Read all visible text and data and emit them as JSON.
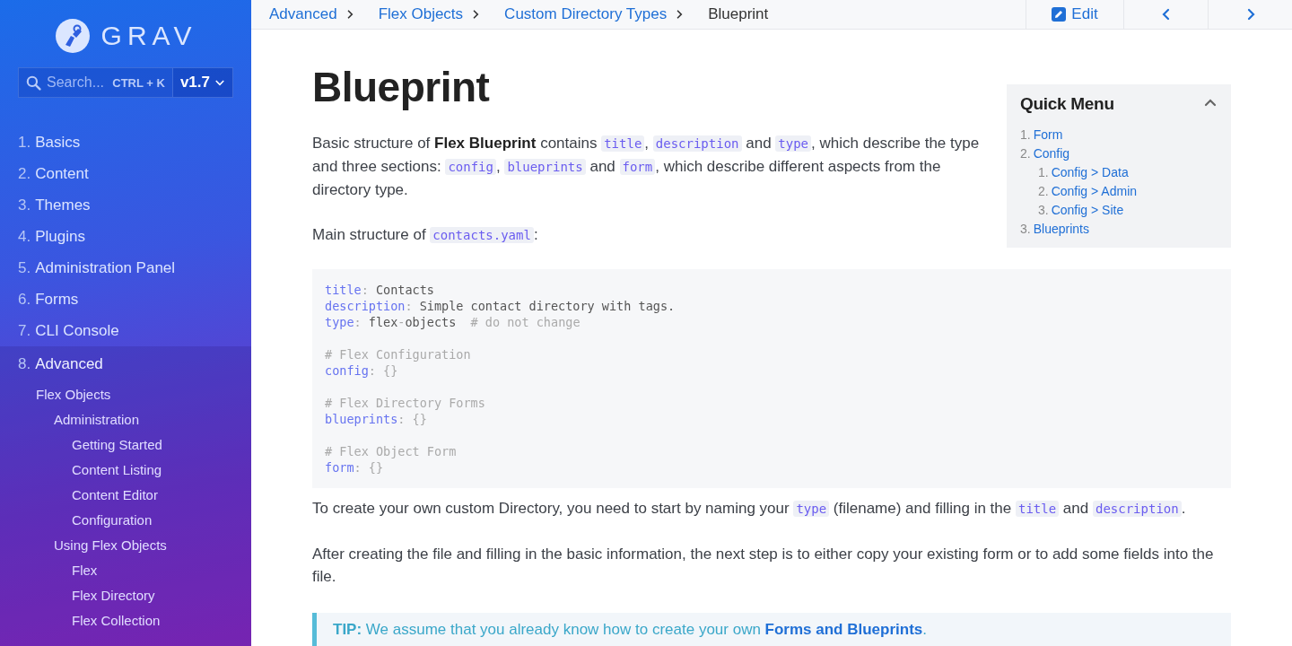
{
  "sidebar": {
    "logo_text": "GRAV",
    "search": {
      "placeholder": "Search...",
      "shortcut": "CTRL + K"
    },
    "version": "v1.7",
    "items": [
      {
        "number": "1.",
        "label": "Basics",
        "expanded": false
      },
      {
        "number": "2.",
        "label": "Content",
        "expanded": false
      },
      {
        "number": "3.",
        "label": "Themes",
        "expanded": false
      },
      {
        "number": "4.",
        "label": "Plugins",
        "expanded": false
      },
      {
        "number": "5.",
        "label": "Administration Panel",
        "expanded": false
      },
      {
        "number": "6.",
        "label": "Forms",
        "expanded": false
      },
      {
        "number": "7.",
        "label": "CLI Console",
        "expanded": false
      },
      {
        "number": "8.",
        "label": "Advanced",
        "expanded": true,
        "children": [
          {
            "label": "Flex Objects",
            "children": [
              {
                "label": "Administration",
                "children": [
                  {
                    "label": "Getting Started"
                  },
                  {
                    "label": "Content Listing"
                  },
                  {
                    "label": "Content Editor"
                  },
                  {
                    "label": "Configuration"
                  }
                ]
              },
              {
                "label": "Using Flex Objects",
                "children": [
                  {
                    "label": "Flex"
                  },
                  {
                    "label": "Flex Directory"
                  },
                  {
                    "label": "Flex Collection"
                  }
                ]
              }
            ]
          }
        ]
      }
    ]
  },
  "topbar": {
    "breadcrumbs": [
      {
        "label": "Advanced",
        "current": false
      },
      {
        "label": "Flex Objects",
        "current": false
      },
      {
        "label": "Custom Directory Types",
        "current": false
      },
      {
        "label": "Blueprint",
        "current": true
      }
    ],
    "edit_button": "Edit"
  },
  "article": {
    "title": "Blueprint",
    "quick_menu": {
      "title": "Quick Menu",
      "expanded": true,
      "items": [
        {
          "number": "1.",
          "label": "Form"
        },
        {
          "number": "2.",
          "label": "Config",
          "children": [
            {
              "number": "1.",
              "label": "Config > Data"
            },
            {
              "number": "2.",
              "label": "Config > Admin"
            },
            {
              "number": "3.",
              "label": "Config > Site"
            }
          ]
        },
        {
          "number": "3.",
          "label": "Blueprints"
        }
      ]
    },
    "intro": [
      [
        {
          "kind": "text",
          "text": "Basic structure of "
        },
        {
          "kind": "bold",
          "text": "Flex Blueprint"
        },
        {
          "kind": "text",
          "text": " contains "
        },
        {
          "kind": "code",
          "text": "title"
        },
        {
          "kind": "text",
          "text": ", "
        },
        {
          "kind": "code",
          "text": "description"
        },
        {
          "kind": "text",
          "text": " and "
        },
        {
          "kind": "code",
          "text": "type"
        },
        {
          "kind": "text",
          "text": ", which describe the type and three sections: "
        },
        {
          "kind": "code",
          "text": "config"
        },
        {
          "kind": "text",
          "text": ", "
        },
        {
          "kind": "code",
          "text": "blueprints"
        },
        {
          "kind": "text",
          "text": " and "
        },
        {
          "kind": "code",
          "text": "form"
        },
        {
          "kind": "text",
          "text": ", which describe different aspects from the directory type."
        }
      ],
      [
        {
          "kind": "text",
          "text": "Main structure of "
        },
        {
          "kind": "code",
          "text": "contacts.yaml"
        },
        {
          "kind": "text",
          "text": ":"
        }
      ]
    ],
    "code_groups": [
      [
        [
          {
            "kind": "key",
            "text": "title"
          },
          {
            "kind": "punct",
            "text": ":"
          },
          {
            "kind": "value",
            "text": " Contacts"
          }
        ],
        [
          {
            "kind": "key",
            "text": "description"
          },
          {
            "kind": "punct",
            "text": ":"
          },
          {
            "kind": "value",
            "text": " Simple contact directory with tags."
          }
        ],
        [
          {
            "kind": "key",
            "text": "type"
          },
          {
            "kind": "punct",
            "text": ":"
          },
          {
            "kind": "value",
            "text": " flex"
          },
          {
            "kind": "punct",
            "text": "-"
          },
          {
            "kind": "value",
            "text": "objects  "
          },
          {
            "kind": "comment",
            "text": "# do not change"
          }
        ]
      ],
      [
        [
          {
            "kind": "comment",
            "text": "# Flex Configuration"
          }
        ],
        [
          {
            "kind": "key",
            "text": "config"
          },
          {
            "kind": "punct",
            "text": ": {}"
          }
        ]
      ],
      [
        [
          {
            "kind": "comment",
            "text": "# Flex Directory Forms"
          }
        ],
        [
          {
            "kind": "key",
            "text": "blueprints"
          },
          {
            "kind": "punct",
            "text": ": {}"
          }
        ]
      ],
      [
        [
          {
            "kind": "comment",
            "text": "# Flex Object Form"
          }
        ],
        [
          {
            "kind": "key",
            "text": "form"
          },
          {
            "kind": "punct",
            "text": ": {}"
          }
        ]
      ]
    ],
    "body": [
      [
        {
          "kind": "text",
          "text": "To create your own custom Directory, you need to start by naming your "
        },
        {
          "kind": "code",
          "text": "type"
        },
        {
          "kind": "text",
          "text": " (filename) and filling in the "
        },
        {
          "kind": "code",
          "text": "title"
        },
        {
          "kind": "text",
          "text": " and "
        },
        {
          "kind": "code",
          "text": "description"
        },
        {
          "kind": "text",
          "text": "."
        }
      ],
      [
        {
          "kind": "text",
          "text": "After creating the file and filling in the basic information, the next step is to either copy your existing form or to add some fields into the file."
        }
      ]
    ],
    "tip": [
      {
        "kind": "bold",
        "text": "TIP:"
      },
      {
        "kind": "text",
        "text": " We assume that you already know how to create your own "
      },
      {
        "kind": "link",
        "text": "Forms and Blueprints"
      },
      {
        "kind": "text",
        "text": "."
      }
    ]
  }
}
